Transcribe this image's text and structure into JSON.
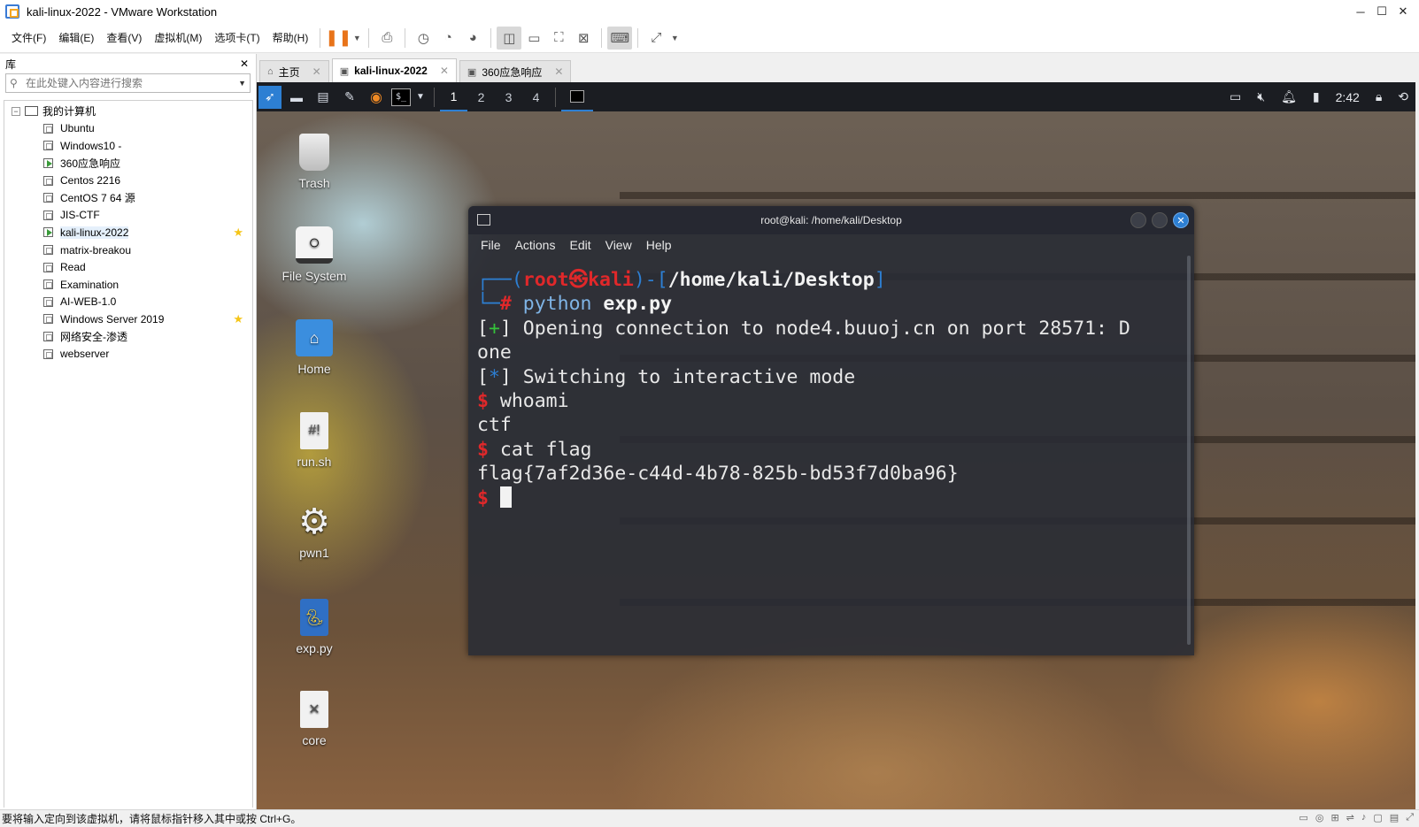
{
  "window": {
    "title": "kali-linux-2022 - VMware Workstation",
    "controls": {
      "minimize": "─",
      "maximize": "☐",
      "close": "✕"
    }
  },
  "menu": [
    "文件(F)",
    "编辑(E)",
    "查看(V)",
    "虚拟机(M)",
    "选项卡(T)",
    "帮助(H)"
  ],
  "library": {
    "title": "库",
    "close": "✕",
    "search_placeholder": "在此处键入内容进行搜索",
    "root": "我的计算机",
    "items": [
      {
        "name": "Ubuntu",
        "running": false,
        "starred": false
      },
      {
        "name": "Windows10 -",
        "running": false,
        "starred": false
      },
      {
        "name": "360应急响应",
        "running": true,
        "starred": false
      },
      {
        "name": "Centos 2216",
        "running": false,
        "starred": false
      },
      {
        "name": "CentOS 7 64 源",
        "running": false,
        "starred": false
      },
      {
        "name": "JIS-CTF",
        "running": false,
        "starred": false
      },
      {
        "name": "kali-linux-2022",
        "running": true,
        "starred": true,
        "selected": true
      },
      {
        "name": "matrix-breakou",
        "running": false,
        "starred": false
      },
      {
        "name": "Read",
        "running": false,
        "starred": false
      },
      {
        "name": "Examination",
        "running": false,
        "starred": false
      },
      {
        "name": "AI-WEB-1.0",
        "running": false,
        "starred": false
      },
      {
        "name": "Windows Server 2019",
        "running": false,
        "starred": true
      },
      {
        "name": "网络安全-渗透",
        "running": false,
        "starred": false
      },
      {
        "name": "webserver",
        "running": false,
        "starred": false
      }
    ]
  },
  "tabs": [
    {
      "label": "主页",
      "icon": "home-icon"
    },
    {
      "label": "kali-linux-2022",
      "icon": "vm-icon",
      "active": true
    },
    {
      "label": "360应急响应",
      "icon": "vm-icon"
    }
  ],
  "kali_panel": {
    "workspaces": [
      "1",
      "2",
      "3",
      "4"
    ],
    "clock": "2:42"
  },
  "desktop_icons": [
    {
      "label": "Trash",
      "icon": "trash-icon"
    },
    {
      "label": "File System",
      "icon": "drive-icon"
    },
    {
      "label": "Home",
      "icon": "home-folder-icon"
    },
    {
      "label": "run.sh",
      "icon": "script-file-icon",
      "glyph": "#!"
    },
    {
      "label": "pwn1",
      "icon": "executable-gear-icon"
    },
    {
      "label": "exp.py",
      "icon": "python-file-icon"
    },
    {
      "label": "core",
      "icon": "broken-file-icon"
    }
  ],
  "terminal": {
    "title": "root@kali: /home/kali/Desktop",
    "menu": [
      "File",
      "Actions",
      "Edit",
      "View",
      "Help"
    ],
    "prompt": {
      "user": "root",
      "at": "㉿",
      "host": "kali",
      "path": "/home/kali/Desktop"
    },
    "command1": "exp.py",
    "command1_prefix": "python ",
    "lines": {
      "opening_tag": "+",
      "opening": " Opening connection to node4.buuoj.cn on port 28571: D",
      "opening_wrap": "one",
      "switch_tag": "*",
      "switching": " Switching to interactive mode",
      "cmd_whoami": "whoami",
      "out_whoami": "ctf",
      "cmd_cat": "cat flag",
      "out_flag": "flag{7af2d36e-c44d-4b78-825b-bd53f7d0ba96}"
    }
  },
  "statusbar": {
    "text": "要将输入定向到该虚拟机，请将鼠标指针移入其中或按 Ctrl+G。"
  }
}
